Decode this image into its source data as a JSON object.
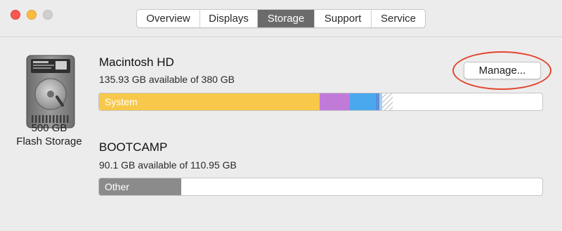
{
  "window": {
    "tabs": [
      {
        "label": "Overview",
        "active": false
      },
      {
        "label": "Displays",
        "active": false
      },
      {
        "label": "Storage",
        "active": true
      },
      {
        "label": "Support",
        "active": false
      },
      {
        "label": "Service",
        "active": false
      }
    ]
  },
  "device": {
    "icon": "hard-drive-icon",
    "capacity": "500 GB",
    "type": "Flash Storage"
  },
  "volumes": [
    {
      "name": "Macintosh HD",
      "available": "135.93 GB available of 380 GB",
      "button": "Manage...",
      "bar": {
        "label": "System",
        "segments": [
          {
            "kind": "system",
            "fraction": 0.498,
            "color": "#f7c84a"
          },
          {
            "kind": "purple",
            "fraction": 0.067,
            "color": "#c27ad9"
          },
          {
            "kind": "blue",
            "fraction": 0.059,
            "color": "#4aa9ee"
          },
          {
            "kind": "dark-blue",
            "fraction": 0.008,
            "color": "#5e8ed6"
          },
          {
            "kind": "light-blue",
            "fraction": 0.006,
            "color": "#a5cdf2"
          },
          {
            "kind": "purgeable",
            "fraction": 0.024,
            "color": "#bdbdbd"
          }
        ]
      }
    },
    {
      "name": "BOOTCAMP",
      "available": "90.1 GB available of 110.95 GB",
      "bar": {
        "label": "Other",
        "segments": [
          {
            "kind": "other",
            "fraction": 0.186,
            "color": "#8b8b8b"
          }
        ]
      }
    }
  ],
  "annotation": {
    "color": "#e2452f"
  }
}
